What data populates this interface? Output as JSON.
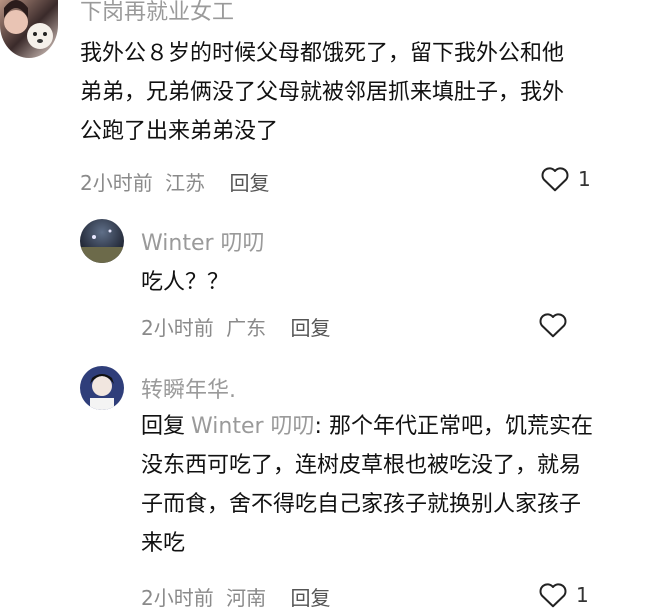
{
  "comment": {
    "username": "下岗再就业女工",
    "text_lines": [
      "我外公８岁的时候父母都饿死了，留下我外公和他",
      "弟弟，兄弟俩没了父母就被邻居抓来填肚子，我外",
      "公跑了出来弟弟没了"
    ],
    "time": "2小时前",
    "location": "江苏",
    "reply_label": "回复",
    "likes": "1"
  },
  "reply1": {
    "username": "Winter 叨叨",
    "text": "吃人？？",
    "time": "2小时前",
    "location": "广东",
    "reply_label": "回复"
  },
  "reply2": {
    "username": "转瞬年华.",
    "reply_prefix": "回复",
    "reply_to": "Winter 叨叨",
    "line1_rest": ": 那个年代正常吧，饥荒实在",
    "text_lines": [
      "没东西可吃了，连树皮草根也被吃没了，就易",
      "子而食，舍不得吃自己家孩子就换别人家孩子",
      "来吃"
    ],
    "time": "2小时前",
    "location": "河南",
    "reply_label": "回复",
    "likes": "1"
  }
}
